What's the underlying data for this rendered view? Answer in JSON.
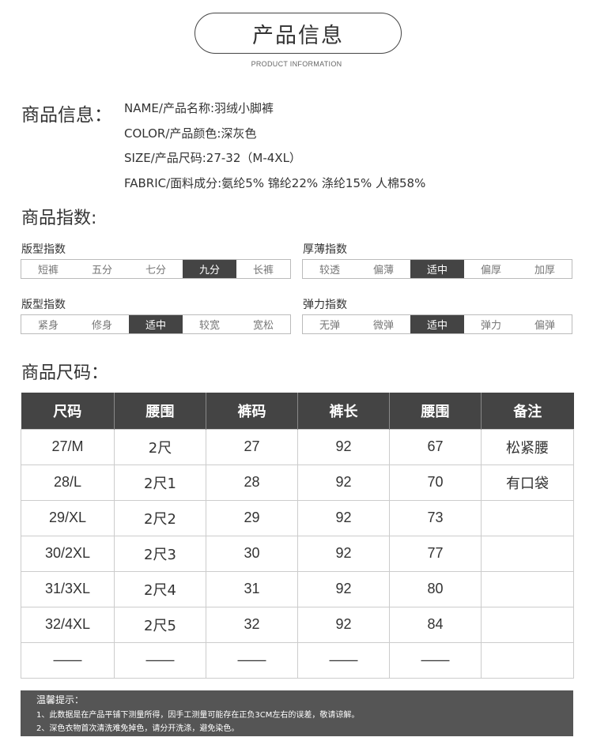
{
  "header": {
    "title": "产品信息",
    "subtitle": "PRODUCT INFORMATION"
  },
  "info": {
    "heading": "商品信息：",
    "lines": [
      "NAME/产品名称:羽绒小脚裤",
      "COLOR/产品颜色:深灰色",
      "SIZE/产品尺码:27-32（M-4XL）",
      "FABRIC/面料成分:氨纶5% 锦纶22% 涤纶15% 人棉58%"
    ]
  },
  "index": {
    "heading": "商品指数:",
    "groups": [
      {
        "label": "版型指数",
        "options": [
          "短裤",
          "五分",
          "七分",
          "九分",
          "长裤"
        ],
        "selected": "九分"
      },
      {
        "label": "厚薄指数",
        "options": [
          "较透",
          "偏薄",
          "适中",
          "偏厚",
          "加厚"
        ],
        "selected": "适中"
      },
      {
        "label": "版型指数",
        "options": [
          "紧身",
          "修身",
          "适中",
          "较宽",
          "宽松"
        ],
        "selected": "适中"
      },
      {
        "label": "弹力指数",
        "options": [
          "无弹",
          "微弹",
          "适中",
          "弹力",
          "偏弹"
        ],
        "selected": "适中"
      }
    ]
  },
  "size": {
    "heading": "商品尺码：",
    "columns": [
      "尺码",
      "腰围",
      "裤码",
      "裤长",
      "腰围",
      "备注"
    ],
    "rows": [
      [
        "27/M",
        "2尺",
        "27",
        "92",
        "67",
        "松紧腰"
      ],
      [
        "28/L",
        "2尺1",
        "28",
        "92",
        "70",
        "有口袋"
      ],
      [
        "29/XL",
        "2尺2",
        "29",
        "92",
        "73",
        ""
      ],
      [
        "30/2XL",
        "2尺3",
        "30",
        "92",
        "77",
        ""
      ],
      [
        "31/3XL",
        "2尺4",
        "31",
        "92",
        "80",
        ""
      ],
      [
        "32/4XL",
        "2尺5",
        "32",
        "92",
        "84",
        ""
      ],
      [
        "——",
        "——",
        "——",
        "——",
        "——",
        ""
      ]
    ]
  },
  "tips": {
    "title": "温馨提示：",
    "lines": [
      "1、此数据是在产品平铺下测量所得，因手工测量可能存在正负3CM左右的误差，敬请谅解。",
      "2、深色衣物首次清洗难免掉色，请分开洗涤，避免染色。"
    ]
  },
  "colors": {
    "dark": "#444444",
    "border": "#cccccc"
  }
}
